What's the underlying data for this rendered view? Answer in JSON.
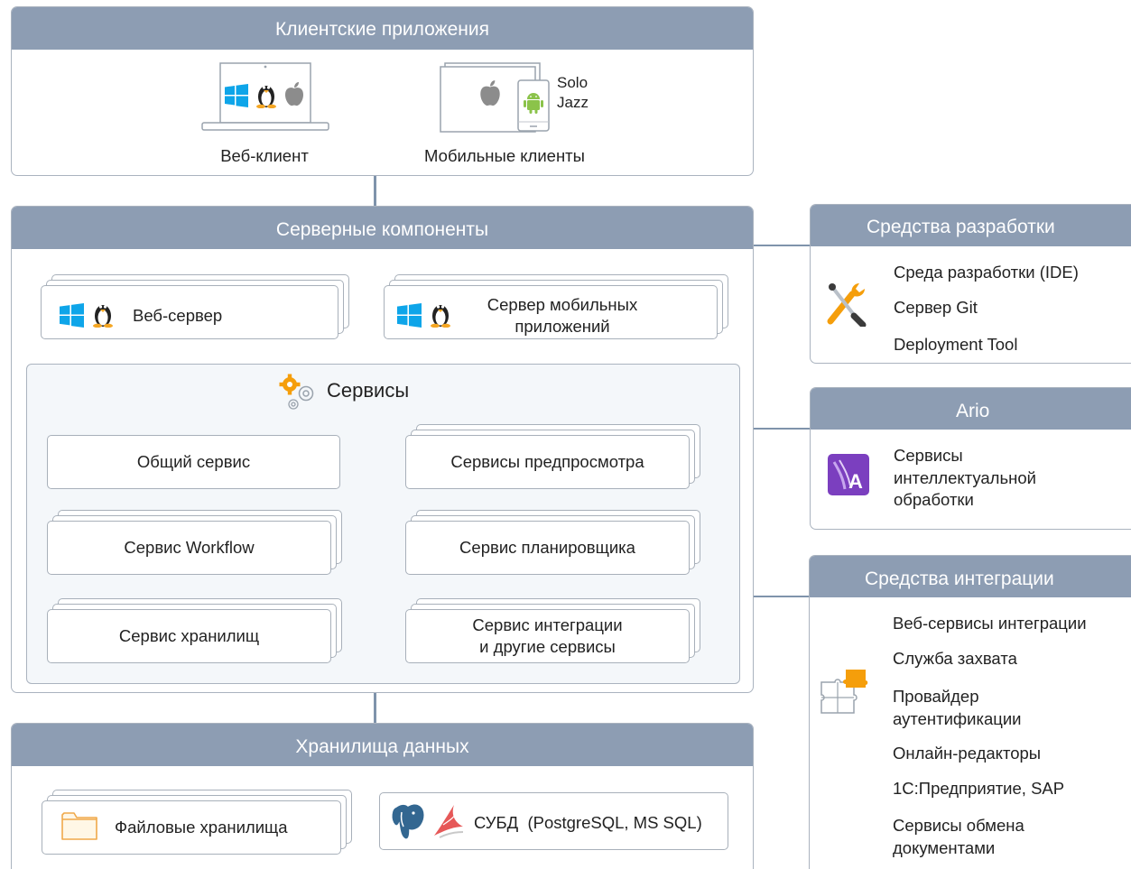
{
  "clients": {
    "title": "Клиентские приложения",
    "web_client": "Веб-клиент",
    "mobile_clients": "Мобильные клиенты",
    "mobile_apps": [
      "Solo",
      "Jazz"
    ]
  },
  "server": {
    "title": "Серверные компоненты",
    "web_server": "Веб-сервер",
    "mobile_server": [
      "Сервер мобильных",
      "приложений"
    ],
    "services_title": "Сервисы",
    "services": {
      "common": "Общий сервис",
      "preview": "Сервисы предпросмотра",
      "workflow": "Сервис Workflow",
      "scheduler": "Сервис планировщика",
      "storage": "Сервис хранилищ",
      "integration": [
        "Сервис интеграции",
        "и другие сервисы"
      ]
    }
  },
  "storage": {
    "title": "Хранилища данных",
    "file": "Файловые хранилища",
    "dbms": "СУБД  (PostgreSQL, MS SQL)"
  },
  "dev": {
    "title": "Средства разработки",
    "items": [
      "Среда разработки (IDE)",
      "Сервер Git",
      "Deployment Tool"
    ]
  },
  "ario": {
    "title": "Ario",
    "items": [
      "Сервисы",
      "интеллектуальной",
      "обработки"
    ],
    "logo_letter": "A"
  },
  "integration": {
    "title": "Средства интеграции",
    "items": [
      "Веб-сервисы интеграции",
      "Служба захвата",
      "Провайдер",
      "аутентификации",
      "Онлайн-редакторы",
      "1С:Предприятие, SAP",
      "Сервисы обмена",
      "документами"
    ]
  },
  "colors": {
    "header": "#8d9db3",
    "border": "#aab3bf",
    "windows": "#0ea5e9",
    "android": "#8bc34a",
    "orange": "#f59e0b",
    "ario": "#7b3fbf"
  }
}
